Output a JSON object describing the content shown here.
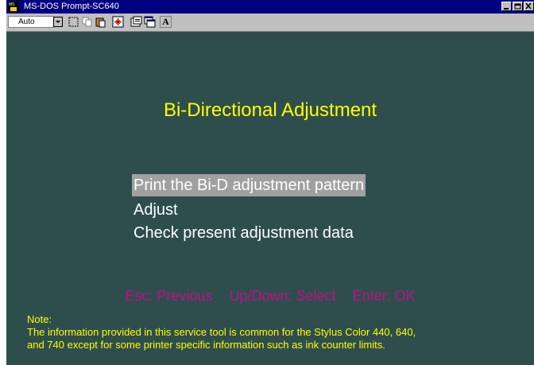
{
  "window": {
    "title": "MS-DOS Prompt-SC640",
    "app_icon": "ms-dos-icon",
    "controls": [
      "minimize-icon",
      "maximize-icon",
      "close-icon"
    ]
  },
  "toolbar": {
    "font_size": "Auto",
    "buttons": [
      "mark-icon",
      "copy-icon",
      "paste-icon",
      "full-screen-icon",
      "properties-icon",
      "background-icon",
      "font-icon"
    ],
    "font_button_label": "A"
  },
  "screen": {
    "background": "#2e4e4e",
    "heading": "Bi-Directional Adjustment",
    "menu": [
      {
        "label": "Print the Bi-D adjustment pattern",
        "selected": true
      },
      {
        "label": "Adjust",
        "selected": false
      },
      {
        "label": "Check present adjustment data",
        "selected": false
      }
    ],
    "hints": [
      "Esc: Previous",
      "Up/Down: Select",
      "Enter: OK"
    ],
    "note": {
      "label": "Note:",
      "line1": "The information provided in this service tool is common for the Stylus Color 440, 640,",
      "line2": "and 740 except for some printer specific information such as ink counter limits."
    },
    "colors": {
      "heading": "#ffff00",
      "menu_text": "#ffffff",
      "selection": "#a0a0a0",
      "hints": "#c01088",
      "note": "#ffff00"
    }
  }
}
